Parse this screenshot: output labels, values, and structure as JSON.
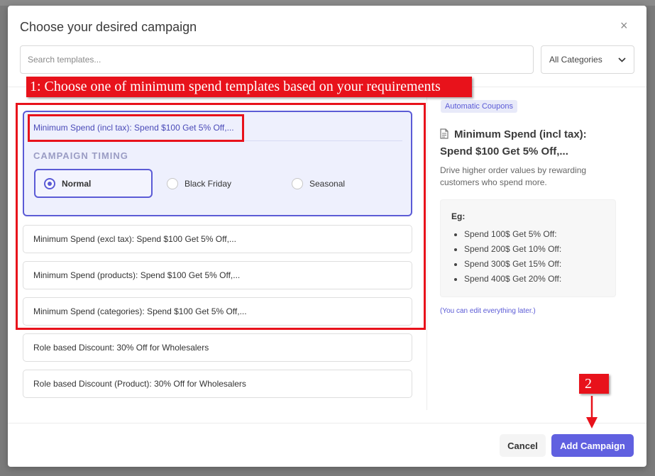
{
  "modal": {
    "title": "Choose your desired campaign",
    "close_symbol": "×",
    "search_placeholder": "Search templates...",
    "category_select": "All Categories"
  },
  "annotations": {
    "step1": "1: Choose one of minimum spend templates based on your requirements",
    "step2": "2",
    "color": "#e8121b"
  },
  "templates": [
    {
      "label": "Minimum Spend (incl tax): Spend $100 Get 5% Off,...",
      "selected": true
    },
    {
      "label": "Minimum Spend (excl tax): Spend $100 Get 5% Off,..."
    },
    {
      "label": "Minimum Spend (products): Spend $100 Get 5% Off,..."
    },
    {
      "label": "Minimum Spend (categories): Spend $100 Get 5% Off,..."
    },
    {
      "label": "Role based Discount: 30% Off for Wholesalers"
    },
    {
      "label": "Role based Discount (Product): 30% Off for Wholesalers"
    }
  ],
  "timing": {
    "label": "CAMPAIGN TIMING",
    "options": [
      {
        "label": "Normal",
        "selected": true
      },
      {
        "label": "Black Friday"
      },
      {
        "label": "Seasonal"
      }
    ]
  },
  "detail": {
    "badge": "Automatic Coupons",
    "icon": "document-icon",
    "title": "Minimum Spend (incl tax): Spend $100 Get 5% Off,...",
    "description": "Drive higher order values by rewarding customers who spend more.",
    "example_label": "Eg:",
    "examples": [
      "Spend 100$ Get 5% Off:",
      "Spend 200$ Get 10% Off:",
      "Spend 300$ Get 15% Off:",
      "Spend 400$ Get 20% Off:"
    ],
    "edit_note": "(You can edit everything later.)"
  },
  "footer": {
    "cancel": "Cancel",
    "add": "Add Campaign"
  },
  "colors": {
    "accent": "#5b5bd6",
    "primary_button": "#6060e0"
  }
}
